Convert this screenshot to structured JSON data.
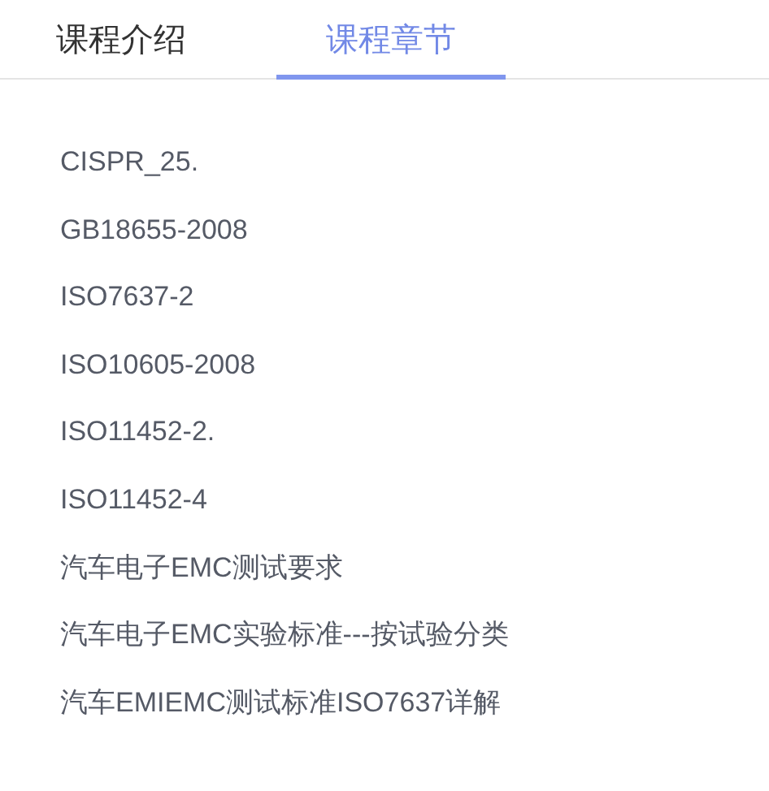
{
  "tabs": [
    {
      "label": "课程介绍",
      "selected": false
    },
    {
      "label": "课程章节",
      "selected": true
    }
  ],
  "chapters": [
    "CISPR_25.",
    "GB18655-2008",
    "ISO7637-2",
    "ISO10605-2008",
    "ISO11452-2.",
    "ISO11452-4",
    "汽车电子EMC测试要求",
    "汽车电子EMC实验标准---按试验分类",
    "汽车EMIEMC测试标准ISO7637详解"
  ]
}
